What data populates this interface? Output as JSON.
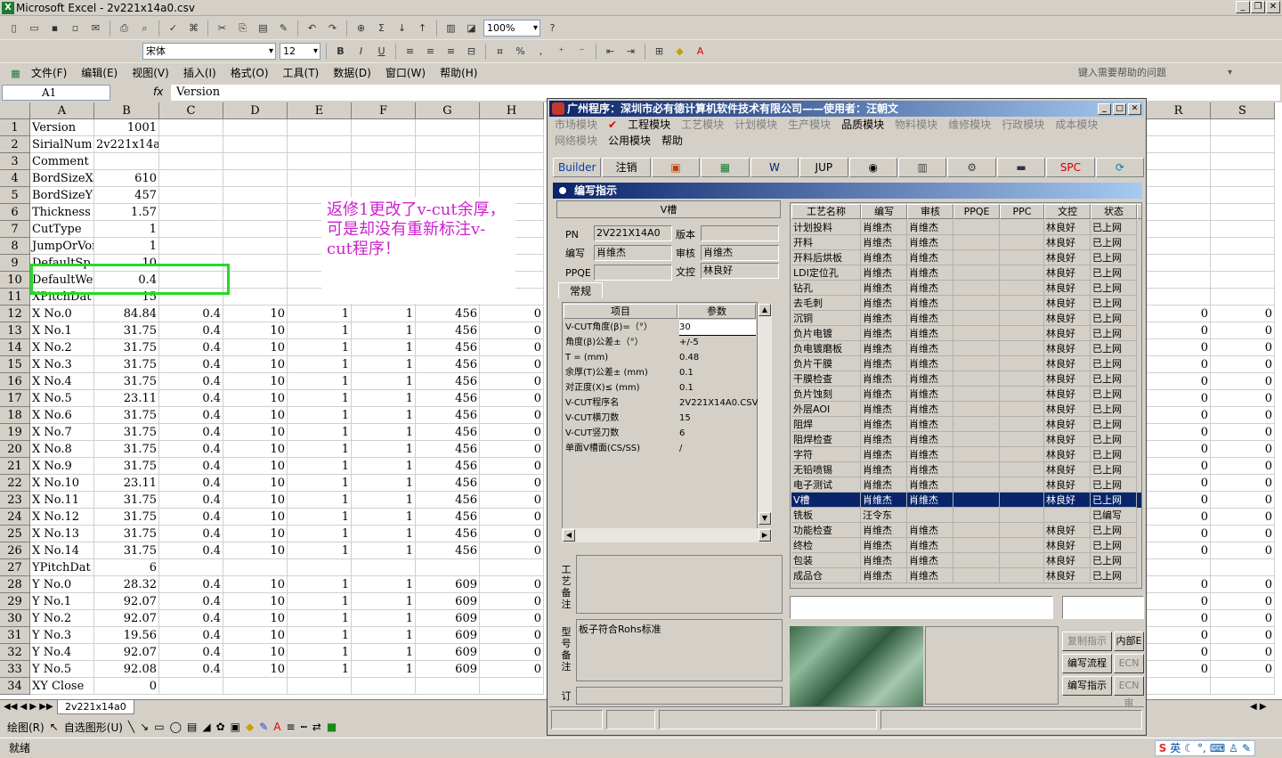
{
  "window": {
    "title": "Microsoft Excel - 2v221x14a0.csv"
  },
  "toolbar": {
    "zoom": "100%",
    "font": "宋体",
    "size": "12"
  },
  "menus": [
    "文件(F)",
    "编辑(E)",
    "视图(V)",
    "插入(I)",
    "格式(O)",
    "工具(T)",
    "数据(D)",
    "窗口(W)",
    "帮助(H)"
  ],
  "help_placeholder": "键入需要帮助的问题",
  "formula": {
    "cell": "A1",
    "fx": "fx",
    "value": "Version"
  },
  "columns": [
    "A",
    "B",
    "C",
    "D",
    "E",
    "F",
    "G",
    "H",
    "R",
    "S"
  ],
  "rows": [
    {
      "n": "1",
      "a": "Version",
      "b": "1001"
    },
    {
      "n": "2",
      "a": "SirialNum",
      "b": "2v221x14a0"
    },
    {
      "n": "3",
      "a": "Comment",
      "b": ""
    },
    {
      "n": "4",
      "a": "BordSizeX",
      "b": "610"
    },
    {
      "n": "5",
      "a": "BordSizeY",
      "b": "457"
    },
    {
      "n": "6",
      "a": "Thickness",
      "b": "1.57"
    },
    {
      "n": "7",
      "a": "CutType",
      "b": "1"
    },
    {
      "n": "8",
      "a": "JumpOrVor",
      "b": "1"
    },
    {
      "n": "9",
      "a": "DefaultSp",
      "b": "10"
    },
    {
      "n": "10",
      "a": "DefaultWe",
      "b": "0.4"
    },
    {
      "n": "11",
      "a": "XPitchDat",
      "b": "15"
    },
    {
      "n": "12",
      "a": "X No.0",
      "b": "84.84",
      "c": "0.4",
      "d": "10",
      "e": "1",
      "f": "1",
      "g": "456",
      "h": "0",
      "r": "0",
      "s": "0"
    },
    {
      "n": "13",
      "a": "X No.1",
      "b": "31.75",
      "c": "0.4",
      "d": "10",
      "e": "1",
      "f": "1",
      "g": "456",
      "h": "0",
      "r": "0",
      "s": "0"
    },
    {
      "n": "14",
      "a": "X No.2",
      "b": "31.75",
      "c": "0.4",
      "d": "10",
      "e": "1",
      "f": "1",
      "g": "456",
      "h": "0",
      "r": "0",
      "s": "0"
    },
    {
      "n": "15",
      "a": "X No.3",
      "b": "31.75",
      "c": "0.4",
      "d": "10",
      "e": "1",
      "f": "1",
      "g": "456",
      "h": "0",
      "r": "0",
      "s": "0"
    },
    {
      "n": "16",
      "a": "X No.4",
      "b": "31.75",
      "c": "0.4",
      "d": "10",
      "e": "1",
      "f": "1",
      "g": "456",
      "h": "0",
      "r": "0",
      "s": "0"
    },
    {
      "n": "17",
      "a": "X No.5",
      "b": "23.11",
      "c": "0.4",
      "d": "10",
      "e": "1",
      "f": "1",
      "g": "456",
      "h": "0",
      "r": "0",
      "s": "0"
    },
    {
      "n": "18",
      "a": "X No.6",
      "b": "31.75",
      "c": "0.4",
      "d": "10",
      "e": "1",
      "f": "1",
      "g": "456",
      "h": "0",
      "r": "0",
      "s": "0"
    },
    {
      "n": "19",
      "a": "X No.7",
      "b": "31.75",
      "c": "0.4",
      "d": "10",
      "e": "1",
      "f": "1",
      "g": "456",
      "h": "0",
      "r": "0",
      "s": "0"
    },
    {
      "n": "20",
      "a": "X No.8",
      "b": "31.75",
      "c": "0.4",
      "d": "10",
      "e": "1",
      "f": "1",
      "g": "456",
      "h": "0",
      "r": "0",
      "s": "0"
    },
    {
      "n": "21",
      "a": "X No.9",
      "b": "31.75",
      "c": "0.4",
      "d": "10",
      "e": "1",
      "f": "1",
      "g": "456",
      "h": "0",
      "r": "0",
      "s": "0"
    },
    {
      "n": "22",
      "a": "X No.10",
      "b": "23.11",
      "c": "0.4",
      "d": "10",
      "e": "1",
      "f": "1",
      "g": "456",
      "h": "0",
      "r": "0",
      "s": "0"
    },
    {
      "n": "23",
      "a": "X No.11",
      "b": "31.75",
      "c": "0.4",
      "d": "10",
      "e": "1",
      "f": "1",
      "g": "456",
      "h": "0",
      "r": "0",
      "s": "0"
    },
    {
      "n": "24",
      "a": "X No.12",
      "b": "31.75",
      "c": "0.4",
      "d": "10",
      "e": "1",
      "f": "1",
      "g": "456",
      "h": "0",
      "r": "0",
      "s": "0"
    },
    {
      "n": "25",
      "a": "X No.13",
      "b": "31.75",
      "c": "0.4",
      "d": "10",
      "e": "1",
      "f": "1",
      "g": "456",
      "h": "0",
      "r": "0",
      "s": "0"
    },
    {
      "n": "26",
      "a": "X No.14",
      "b": "31.75",
      "c": "0.4",
      "d": "10",
      "e": "1",
      "f": "1",
      "g": "456",
      "h": "0",
      "r": "0",
      "s": "0"
    },
    {
      "n": "27",
      "a": "YPitchDat",
      "b": "6"
    },
    {
      "n": "28",
      "a": "Y No.0",
      "b": "28.32",
      "c": "0.4",
      "d": "10",
      "e": "1",
      "f": "1",
      "g": "609",
      "h": "0",
      "r": "0",
      "s": "0"
    },
    {
      "n": "29",
      "a": "Y No.1",
      "b": "92.07",
      "c": "0.4",
      "d": "10",
      "e": "1",
      "f": "1",
      "g": "609",
      "h": "0",
      "r": "0",
      "s": "0"
    },
    {
      "n": "30",
      "a": "Y No.2",
      "b": "92.07",
      "c": "0.4",
      "d": "10",
      "e": "1",
      "f": "1",
      "g": "609",
      "h": "0",
      "r": "0",
      "s": "0"
    },
    {
      "n": "31",
      "a": "Y No.3",
      "b": "19.56",
      "c": "0.4",
      "d": "10",
      "e": "1",
      "f": "1",
      "g": "609",
      "h": "0",
      "r": "0",
      "s": "0"
    },
    {
      "n": "32",
      "a": "Y No.4",
      "b": "92.07",
      "c": "0.4",
      "d": "10",
      "e": "1",
      "f": "1",
      "g": "609",
      "h": "0",
      "r": "0",
      "s": "0"
    },
    {
      "n": "33",
      "a": "Y No.5",
      "b": "92.08",
      "c": "0.4",
      "d": "10",
      "e": "1",
      "f": "1",
      "g": "609",
      "h": "0",
      "r": "0",
      "s": "0"
    },
    {
      "n": "34",
      "a": "XY Close",
      "b": "0"
    }
  ],
  "annotation": "返修1更改了v-cut余厚，可是却没有重新标注v-cut程序！",
  "sheet_tab": "2v221x14a0",
  "draw_label": "绘图(R)",
  "autoshape_label": "自选图形(U)",
  "status": "就绪",
  "ime": "英",
  "app": {
    "title": "广州程序：深圳市必有德计算机软件技术有限公司——使用者：汪朝文",
    "modules1": [
      "市场模块",
      "工程模块",
      "工艺模块",
      "计划模块",
      "生产模块",
      "品质模块",
      "物料模块",
      "维修模块",
      "行政模块",
      "成本模块"
    ],
    "modules2": [
      "网络模块",
      "公用模块",
      "帮助"
    ],
    "buttons": [
      "Builder",
      "注销",
      "",
      "",
      "W",
      "JUP",
      "",
      "",
      "",
      "",
      "SPC",
      ""
    ],
    "panel_title": "编写指示",
    "section": "V槽",
    "pn_label": "PN",
    "pn": "2V221X14A0",
    "ver_label": "版本",
    "ver": "",
    "author_label": "编写",
    "author": "肖维杰",
    "review_label": "审核",
    "review": "肖维杰",
    "ppqe_label": "PPQE",
    "ppqe": "",
    "doc_label": "文控",
    "doc": "林良好",
    "tab": "常规",
    "param_headers": [
      "项目",
      "参数"
    ],
    "params": [
      [
        "V-CUT角度(β)=（°）",
        "30"
      ],
      [
        "角度(β)公差±（°）",
        "+/-5"
      ],
      [
        "T =  (mm)",
        "0.48"
      ],
      [
        "余厚(T)公差±  (mm)",
        "0.1"
      ],
      [
        "对正度(X)≤  (mm)",
        "0.1"
      ],
      [
        "V-CUT程序名",
        "2V221X14A0.CSV"
      ],
      [
        "V-CUT横刀数",
        "15"
      ],
      [
        "V-CUT竖刀数",
        "6"
      ],
      [
        "单面V槽面(CS/SS)",
        "/"
      ]
    ],
    "memo1_label": "工艺备注",
    "memo2_label": "型号备注",
    "memo2": "板子符合Rohs标准",
    "memo3_label": "订",
    "grid_headers": [
      "工艺名称",
      "编写",
      "审核",
      "PPQE",
      "PPC",
      "文控",
      "状态",
      "文"
    ],
    "grid": [
      [
        "计划投料",
        "肖维杰",
        "肖维杰",
        "",
        "",
        "林良好",
        "已上网"
      ],
      [
        "开料",
        "肖维杰",
        "肖维杰",
        "",
        "",
        "林良好",
        "已上网"
      ],
      [
        "开料后烘板",
        "肖维杰",
        "肖维杰",
        "",
        "",
        "林良好",
        "已上网"
      ],
      [
        "LDI定位孔",
        "肖维杰",
        "肖维杰",
        "",
        "",
        "林良好",
        "已上网"
      ],
      [
        "钻孔",
        "肖维杰",
        "肖维杰",
        "",
        "",
        "林良好",
        "已上网"
      ],
      [
        "去毛刺",
        "肖维杰",
        "肖维杰",
        "",
        "",
        "林良好",
        "已上网"
      ],
      [
        "沉铜",
        "肖维杰",
        "肖维杰",
        "",
        "",
        "林良好",
        "已上网"
      ],
      [
        "负片电镀",
        "肖维杰",
        "肖维杰",
        "",
        "",
        "林良好",
        "已上网"
      ],
      [
        "负电镀磨板",
        "肖维杰",
        "肖维杰",
        "",
        "",
        "林良好",
        "已上网"
      ],
      [
        "负片干膜",
        "肖维杰",
        "肖维杰",
        "",
        "",
        "林良好",
        "已上网"
      ],
      [
        "干膜检查",
        "肖维杰",
        "肖维杰",
        "",
        "",
        "林良好",
        "已上网"
      ],
      [
        "负片蚀刻",
        "肖维杰",
        "肖维杰",
        "",
        "",
        "林良好",
        "已上网"
      ],
      [
        "外层AOI",
        "肖维杰",
        "肖维杰",
        "",
        "",
        "林良好",
        "已上网"
      ],
      [
        "阻焊",
        "肖维杰",
        "肖维杰",
        "",
        "",
        "林良好",
        "已上网"
      ],
      [
        "阻焊检查",
        "肖维杰",
        "肖维杰",
        "",
        "",
        "林良好",
        "已上网"
      ],
      [
        "字符",
        "肖维杰",
        "肖维杰",
        "",
        "",
        "林良好",
        "已上网"
      ],
      [
        "无铅喷锡",
        "肖维杰",
        "肖维杰",
        "",
        "",
        "林良好",
        "已上网"
      ],
      [
        "电子测试",
        "肖维杰",
        "肖维杰",
        "",
        "",
        "林良好",
        "已上网"
      ],
      [
        "V槽",
        "肖维杰",
        "肖维杰",
        "",
        "",
        "林良好",
        "已上网"
      ],
      [
        "铣板",
        "汪令东",
        "",
        "",
        "",
        "",
        "已编写"
      ],
      [
        "功能检查",
        "肖维杰",
        "肖维杰",
        "",
        "",
        "林良好",
        "已上网"
      ],
      [
        "终检",
        "肖维杰",
        "肖维杰",
        "",
        "",
        "林良好",
        "已上网"
      ],
      [
        "包装",
        "肖维杰",
        "肖维杰",
        "",
        "",
        "林良好",
        "已上网"
      ],
      [
        "成品仓",
        "肖维杰",
        "肖维杰",
        "",
        "",
        "林良好",
        "已上网"
      ]
    ],
    "side_buttons": [
      "复制指示",
      "内部E",
      "编写流程",
      "ECN影",
      "编写指示",
      "ECN审"
    ]
  }
}
